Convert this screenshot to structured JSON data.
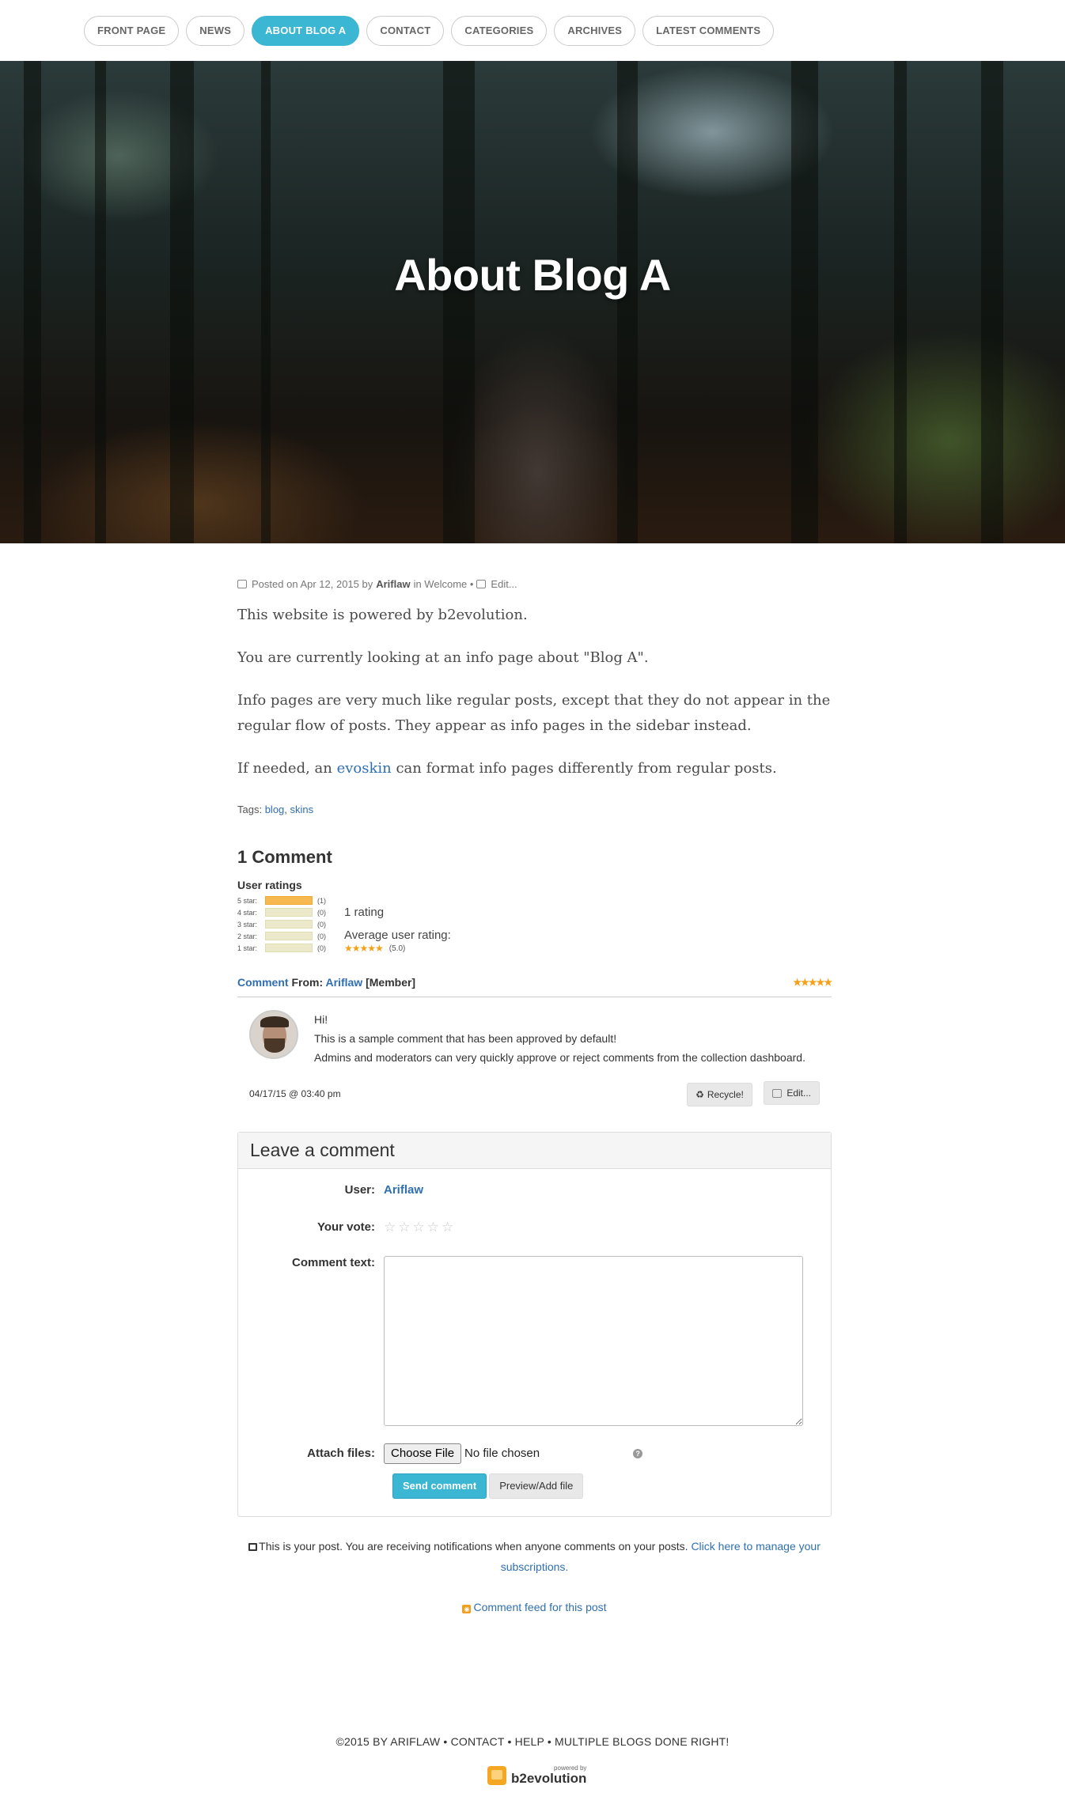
{
  "nav": {
    "items": [
      {
        "label": "FRONT PAGE",
        "active": false
      },
      {
        "label": "NEWS",
        "active": false
      },
      {
        "label": "ABOUT BLOG A",
        "active": true
      },
      {
        "label": "CONTACT",
        "active": false
      },
      {
        "label": "CATEGORIES",
        "active": false
      },
      {
        "label": "ARCHIVES",
        "active": false
      },
      {
        "label": "LATEST COMMENTS",
        "active": false
      }
    ]
  },
  "hero": {
    "title": "About Blog A"
  },
  "post": {
    "meta": {
      "posted_on": "Posted on Apr 12, 2015 by",
      "author": "Ariflaw",
      "in": "in Welcome •",
      "edit": "Edit..."
    },
    "paragraphs": {
      "p1": "This website is powered by b2evolution.",
      "p2": "You are currently looking at an info page about \"Blog A\".",
      "p3": "Info pages are very much like regular posts, except that they do not appear in the regular flow of posts. They appear as info pages in the sidebar instead.",
      "p4_before": "If needed, an ",
      "p4_link": "evoskin",
      "p4_after": " can format info pages differently from regular posts."
    },
    "tags": {
      "label": "Tags:",
      "items": [
        "blog",
        "skins"
      ]
    }
  },
  "comments": {
    "title": "1 Comment",
    "ratings_title": "User ratings",
    "rating_rows": [
      {
        "label": "5 star:",
        "count": "(1)"
      },
      {
        "label": "4 star:",
        "count": "(0)"
      },
      {
        "label": "3 star:",
        "count": "(0)"
      },
      {
        "label": "2 star:",
        "count": "(0)"
      },
      {
        "label": "1 star:",
        "count": "(0)"
      }
    ],
    "rating_count": "1 rating",
    "average_label": "Average user rating:",
    "average_stars": "★★★★★",
    "average_value": "(5.0)",
    "items": [
      {
        "type_label": "Comment",
        "from_label": "From:",
        "author": "Ariflaw",
        "role": "[Member]",
        "stars": "★★★★★",
        "lines": {
          "l1": "Hi!",
          "l2": "This is a sample comment that has been approved by default!",
          "l3": "Admins and moderators can very quickly approve or reject comments from the collection dashboard."
        },
        "date": "04/17/15 @ 03:40 pm",
        "recycle_label": "Recycle!",
        "edit_label": "Edit..."
      }
    ]
  },
  "leave_comment": {
    "title": "Leave a comment",
    "user_label": "User:",
    "user_value": "Ariflaw",
    "vote_label": "Your vote:",
    "vote_stars": [
      "☆",
      "☆",
      "☆",
      "☆",
      "☆"
    ],
    "text_label": "Comment text:",
    "attach_label": "Attach files:",
    "choose_file": "Choose File",
    "no_file": "No file chosen",
    "help": "?",
    "send_label": "Send comment",
    "preview_label": "Preview/Add file"
  },
  "notify": {
    "text": "This is your post. You are receiving notifications when anyone comments on your posts.",
    "link": "Click here to manage your subscriptions."
  },
  "feed": {
    "label": "Comment feed for this post"
  },
  "footer": {
    "copyright": "©2015 BY ARIFLAW • CONTACT • HELP • MULTIPLE BLOGS DONE RIGHT!",
    "powered_small": "powered by",
    "powered_big": "b2evolution"
  },
  "colors": {
    "accent": "#3bb6d3",
    "link": "#2f6fb0",
    "star": "#f4a11a"
  },
  "icons": {
    "post_meta": "edit-icon",
    "mail": "envelope-icon",
    "feed": "rss-icon",
    "recycle": "recycle-icon"
  }
}
